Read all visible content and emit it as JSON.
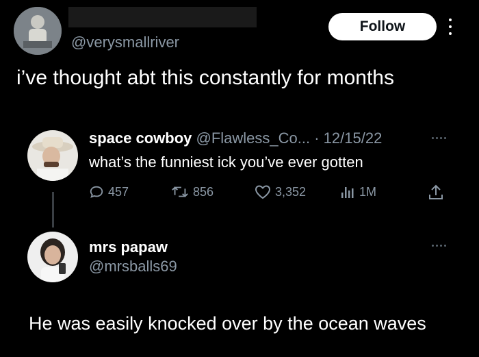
{
  "main_tweet": {
    "handle": "@verysmallriver",
    "follow_label": "Follow",
    "text": "i’ve thought abt this constantly for months"
  },
  "quoted_tweet": {
    "display_name": "space cowboy",
    "handle_date": "@Flawless_Co... · 12/15/22",
    "text": "what’s the funniest ick you’ve ever gotten",
    "stats": {
      "replies": "457",
      "retweets": "856",
      "likes": "3,352",
      "views": "1M"
    }
  },
  "reply": {
    "display_name": "mrs papaw",
    "handle": "@mrsballs69",
    "text": "He was easily knocked over by the ocean waves"
  },
  "icons": {
    "more": "more-vertical-icon",
    "more_h": "more-horizontal-icon",
    "reply": "reply-icon",
    "retweet": "retweet-icon",
    "like": "heart-icon",
    "views": "views-icon",
    "share": "share-icon"
  },
  "colors": {
    "background": "#000000",
    "text": "#ffffff",
    "muted": "#8b98a5",
    "follow_bg": "#ffffff"
  }
}
